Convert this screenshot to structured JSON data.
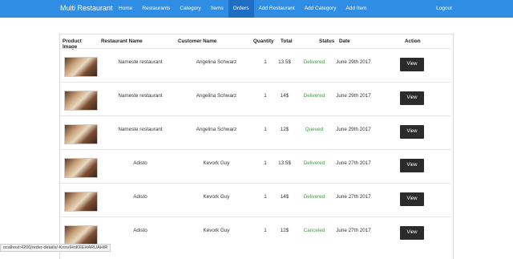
{
  "navbar": {
    "brand": "Multi Restaurant",
    "items": [
      "Home",
      "Restaurants",
      "Category",
      "Items",
      "Orders",
      "Add Restaurant",
      "Add Category",
      "Add Item"
    ],
    "active_index": 4,
    "logout": "Logout"
  },
  "table": {
    "headers": {
      "image": "Product Image",
      "restaurant": "Restaurant Name",
      "customer": "Customer Name",
      "quantity": "Quantity",
      "total": "Total",
      "status": "Status",
      "date": "Date",
      "action": "Action"
    },
    "rows": [
      {
        "restaurant": "Nameste restaurant",
        "customer": "Angelina Schwarz",
        "quantity": "1",
        "total": "13.5$",
        "status": "Delivered",
        "date": "June 29th 2017",
        "action": "View"
      },
      {
        "restaurant": "Nameste restaurant",
        "customer": "Angelina Schwarz",
        "quantity": "1",
        "total": "14$",
        "status": "Delivered",
        "date": "June 29th 2017",
        "action": "View"
      },
      {
        "restaurant": "Nameste restaurant",
        "customer": "Angelina Schwarz",
        "quantity": "1",
        "total": "12$",
        "status": "Queued",
        "date": "June 29th 2017",
        "action": "View"
      },
      {
        "restaurant": "Adisto",
        "customer": "Kevork Guy",
        "quantity": "1",
        "total": "13.5$",
        "status": "Delivered",
        "date": "June 27th 2017",
        "action": "View"
      },
      {
        "restaurant": "Adisto",
        "customer": "Kevork Guy",
        "quantity": "1",
        "total": "14$",
        "status": "Delivered",
        "date": "June 27th 2017",
        "action": "View"
      },
      {
        "restaurant": "Adisto",
        "customer": "Kevork Guy",
        "quantity": "1",
        "total": "12$",
        "status": "Canceled",
        "date": "June 27th 2017",
        "action": "View"
      }
    ]
  },
  "statusbar": {
    "url": "ocalhost:4200/order-details/-KnnvIHnKFEHARUAHtR"
  }
}
